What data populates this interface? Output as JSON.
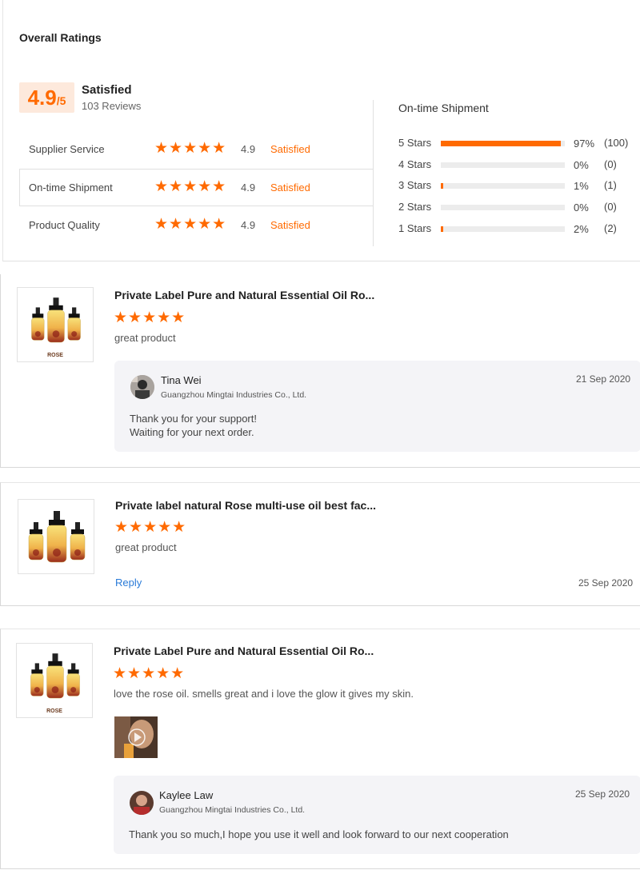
{
  "overall": {
    "title": "Overall Ratings",
    "score_big": "4.9",
    "score_small": "/5",
    "satisfaction": "Satisfied",
    "reviews": "103 Reviews",
    "categories": [
      {
        "label": "Supplier Service",
        "stars": "★★★★★",
        "score": "4.9",
        "status": "Satisfied"
      },
      {
        "label": "On-time Shipment",
        "stars": "★★★★★",
        "score": "4.9",
        "status": "Satisfied"
      },
      {
        "label": "Product Quality",
        "stars": "★★★★★",
        "score": "4.9",
        "status": "Satisfied"
      }
    ]
  },
  "shipment": {
    "title": "On-time Shipment",
    "rows": [
      {
        "label": "5 Stars",
        "pct": "97%",
        "count": "(100)",
        "fill": 0.97
      },
      {
        "label": "4 Stars",
        "pct": "0%",
        "count": "(0)",
        "fill": 0
      },
      {
        "label": "3 Stars",
        "pct": "1%",
        "count": "(1)",
        "fill": 0.01
      },
      {
        "label": "2 Stars",
        "pct": "0%",
        "count": "(0)",
        "fill": 0
      },
      {
        "label": "1 Stars",
        "pct": "2%",
        "count": "(2)",
        "fill": 0.02
      }
    ]
  },
  "reviews": [
    {
      "product": "Private Label Pure and Natural Essential Oil Ro...",
      "stars": "★★★★★",
      "text": "great product",
      "thumb_caption": "ROSE",
      "reply": {
        "name": "Tina Wei",
        "company": "Guangzhou Mingtai Industries Co., Ltd.",
        "date": "21 Sep 2020",
        "text": "Thank you for  your support!\nWaiting for your next order."
      }
    },
    {
      "product": "Private label natural Rose multi-use oil best fac...",
      "stars": "★★★★★",
      "text": "great product",
      "reply_label": "Reply",
      "date": "25 Sep 2020"
    },
    {
      "product": "Private Label Pure and Natural Essential Oil Ro...",
      "stars": "★★★★★",
      "text": "love the rose oil. smells great and i love the glow it gives my skin.",
      "thumb_caption": "ROSE",
      "reply": {
        "name": "Kaylee Law",
        "company": "Guangzhou Mingtai Industries Co., Ltd.",
        "date": "25 Sep 2020",
        "text": "Thank you so much,I hope you use it well and look forward to our next cooperation"
      }
    }
  ],
  "colors": {
    "accent": "#ff6a00",
    "badge_bg": "#fde9dc",
    "link": "#2a7bd8",
    "reply_bg": "#f4f4f7"
  },
  "icons": [
    "star-icon",
    "play-icon",
    "bottle-image"
  ]
}
